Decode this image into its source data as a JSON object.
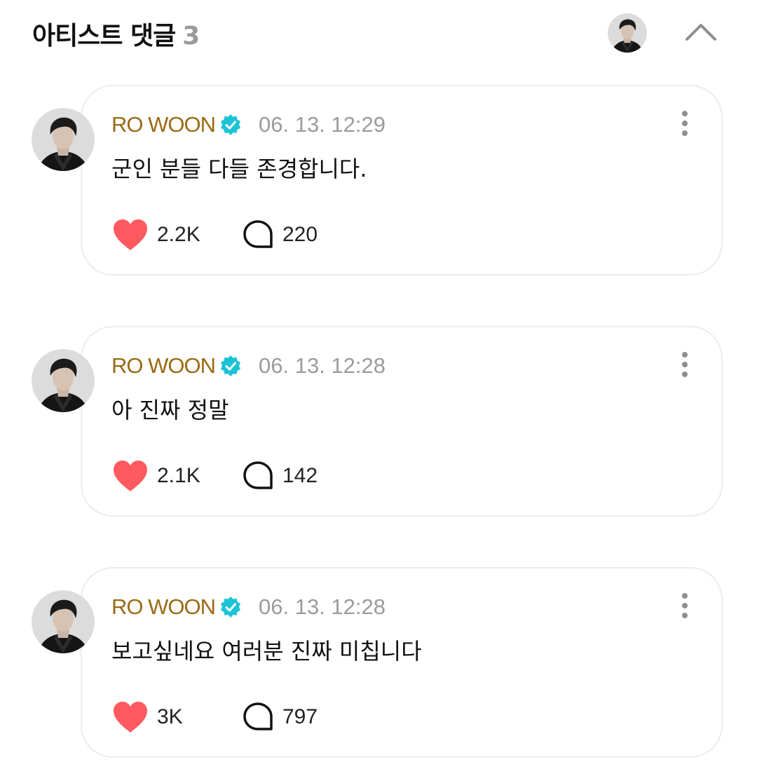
{
  "header": {
    "title": "아티스트 댓글",
    "count": "3",
    "avatar_icon": "artist-avatar-icon",
    "collapse_icon": "chevron-up-icon"
  },
  "colors": {
    "author": "#9a6a14",
    "verified": "#1cc3d6",
    "heart": "#ff5a5f",
    "timestamp": "#9b9b9b"
  },
  "comments": [
    {
      "author": "RO WOON",
      "time": "06. 13. 12:29",
      "text": "군인 분들 다들 존경합니다.",
      "likes": "2.2K",
      "replies": "220"
    },
    {
      "author": "RO WOON",
      "time": "06. 13. 12:28",
      "text": "아 진짜 정말",
      "likes": "2.1K",
      "replies": "142"
    },
    {
      "author": "RO WOON",
      "time": "06. 13. 12:28",
      "text": "보고싶네요 여러분 진짜 미칩니다",
      "likes": "3K",
      "replies": "797"
    }
  ]
}
